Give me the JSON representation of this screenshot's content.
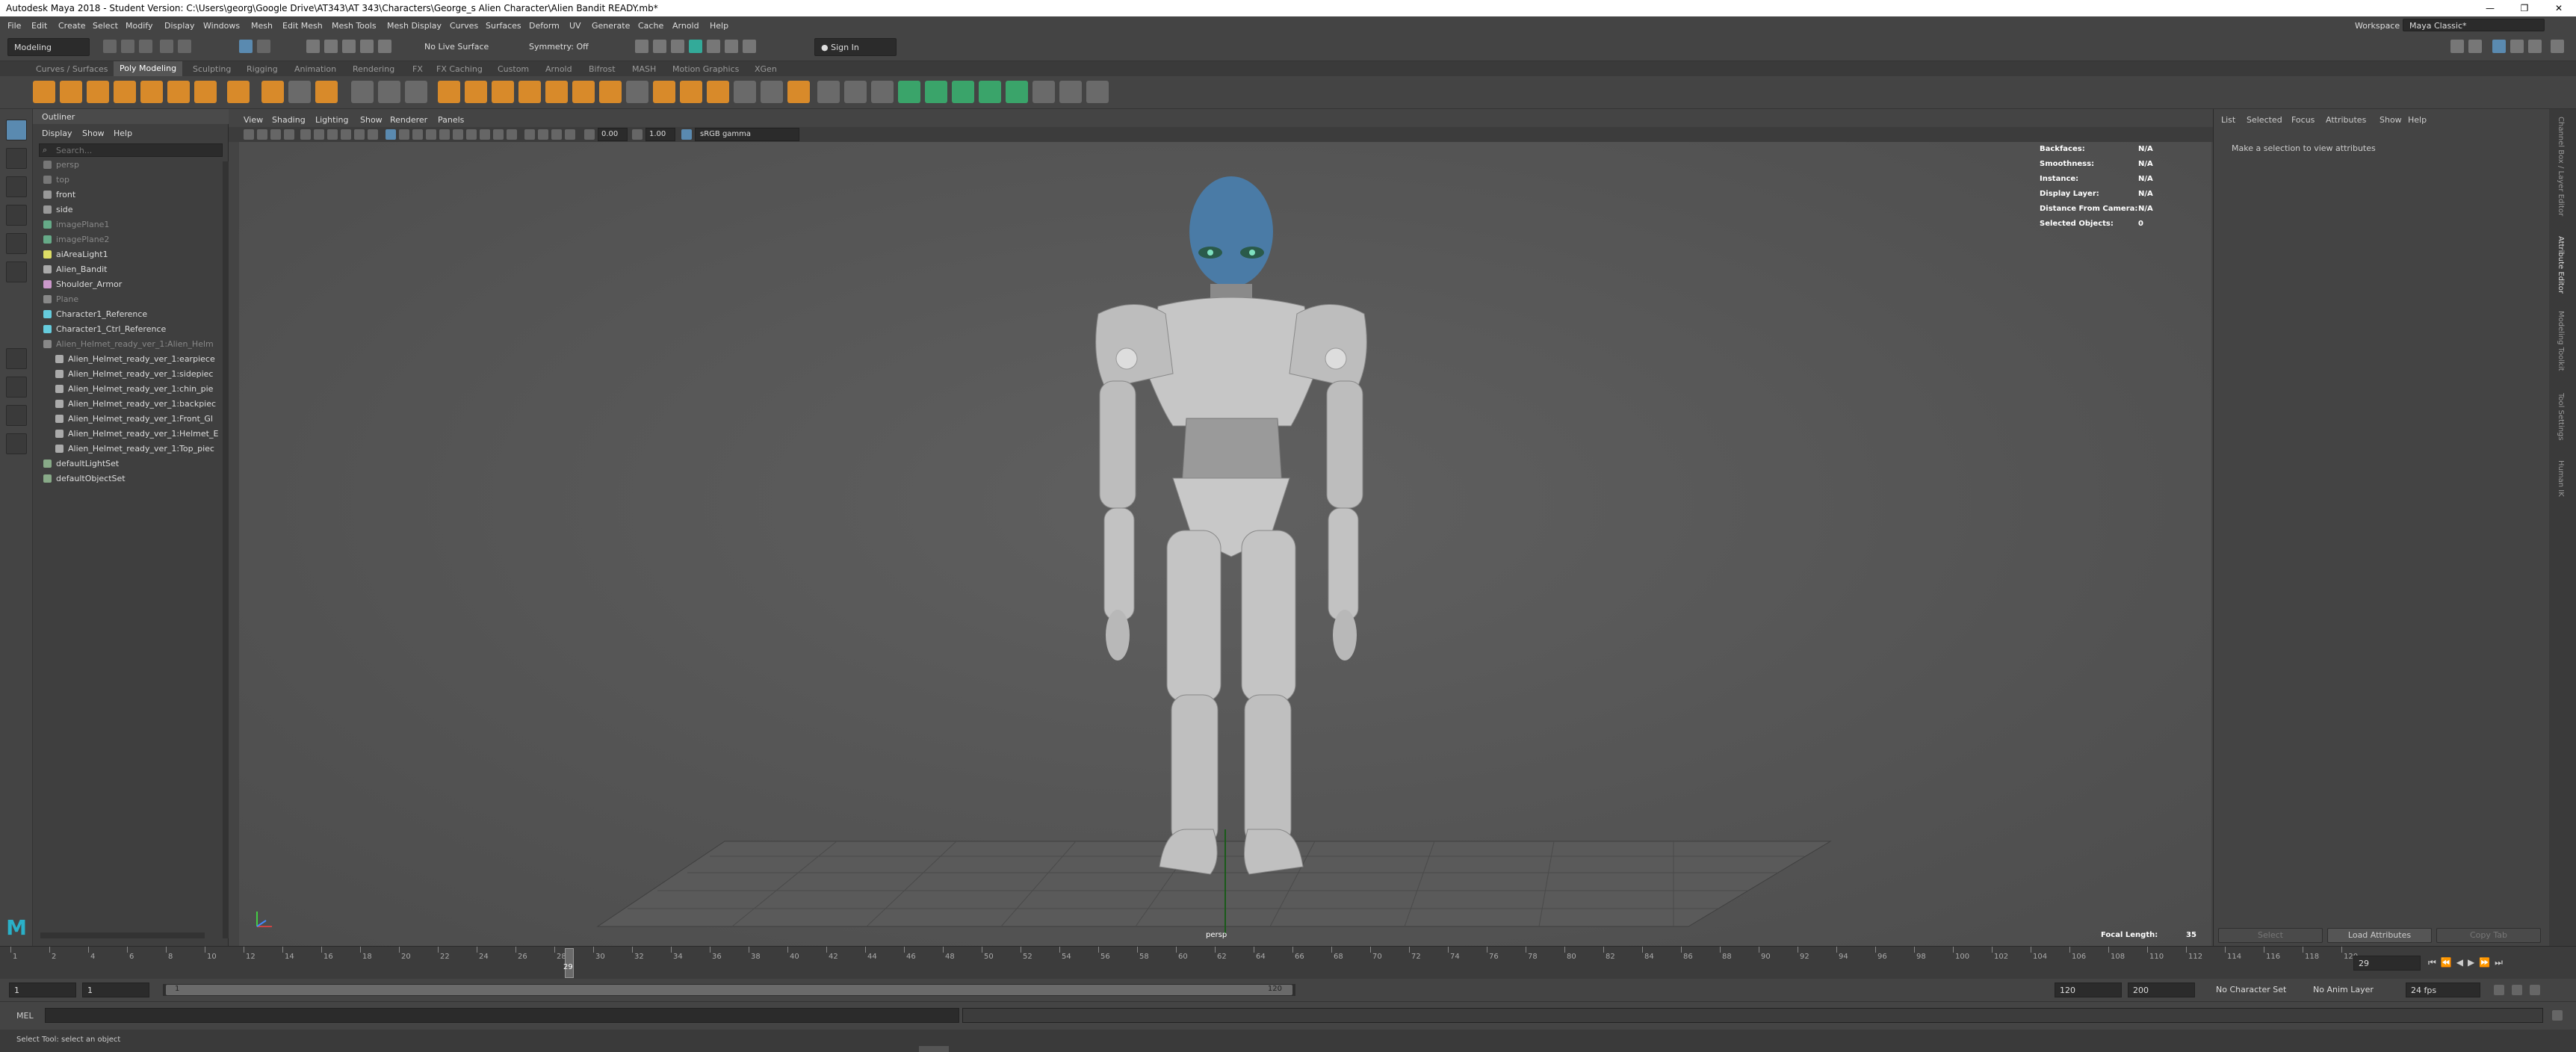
{
  "window": {
    "title": "Autodesk Maya 2018 - Student Version: C:\\Users\\georg\\Google Drive\\AT343\\AT 343\\Characters\\George_s Alien Character\\Alien Bandit READY.mb*",
    "min": "—",
    "max": "❐",
    "close": "✕"
  },
  "menubar": {
    "items": [
      "File",
      "Edit",
      "Create",
      "Select",
      "Modify",
      "Display",
      "Windows",
      "Mesh",
      "Edit Mesh",
      "Mesh Tools",
      "Mesh Display",
      "Curves",
      "Surfaces",
      "Deform",
      "UV",
      "Generate",
      "Cache",
      "Arnold",
      "Help"
    ],
    "workspace_label": "Workspace :",
    "workspace_value": "Maya Classic*"
  },
  "statusline": {
    "mode": "Modeling",
    "live_surface": "No Live Surface",
    "symmetry": "Symmetry: Off",
    "sign_in": "Sign In"
  },
  "shelf": {
    "tabs": [
      "Curves / Surfaces",
      "Poly Modeling",
      "Sculpting",
      "Rigging",
      "Animation",
      "Rendering",
      "FX",
      "FX Caching",
      "Custom",
      "Arnold",
      "Bifrost",
      "MASH",
      "Motion Graphics",
      "XGen"
    ],
    "active_tab": "Poly Modeling"
  },
  "outliner": {
    "title": "Outliner",
    "menu": [
      "Display",
      "Show",
      "Help"
    ],
    "search_placeholder": "Search...",
    "items": [
      {
        "label": "persp",
        "dim": true,
        "indent": 0,
        "color": "#777"
      },
      {
        "label": "top",
        "dim": true,
        "indent": 0,
        "color": "#777"
      },
      {
        "label": "front",
        "dim": false,
        "indent": 0,
        "color": "#999"
      },
      {
        "label": "side",
        "dim": false,
        "indent": 0,
        "color": "#999"
      },
      {
        "label": "imagePlane1",
        "dim": true,
        "indent": 0,
        "color": "#6a8"
      },
      {
        "label": "imagePlane2",
        "dim": true,
        "indent": 0,
        "color": "#6a8"
      },
      {
        "label": "aiAreaLight1",
        "dim": false,
        "indent": 0,
        "color": "#dd6"
      },
      {
        "label": "Alien_Bandit",
        "dim": false,
        "indent": 0,
        "color": "#aaa"
      },
      {
        "label": "Shoulder_Armor",
        "dim": false,
        "indent": 0,
        "color": "#c9c"
      },
      {
        "label": "Plane",
        "dim": true,
        "indent": 0,
        "color": "#888"
      },
      {
        "label": "Character1_Reference",
        "dim": false,
        "indent": 0,
        "color": "#6cd"
      },
      {
        "label": "Character1_Ctrl_Reference",
        "dim": false,
        "indent": 0,
        "color": "#6cd"
      },
      {
        "label": "Alien_Helmet_ready_ver_1:Alien_Helm",
        "dim": true,
        "indent": 0,
        "color": "#888"
      },
      {
        "label": "Alien_Helmet_ready_ver_1:earpiece",
        "dim": false,
        "indent": 1,
        "color": "#aaa"
      },
      {
        "label": "Alien_Helmet_ready_ver_1:sidepiec",
        "dim": false,
        "indent": 1,
        "color": "#aaa"
      },
      {
        "label": "Alien_Helmet_ready_ver_1:chin_pie",
        "dim": false,
        "indent": 1,
        "color": "#aaa"
      },
      {
        "label": "Alien_Helmet_ready_ver_1:backpiec",
        "dim": false,
        "indent": 1,
        "color": "#aaa"
      },
      {
        "label": "Alien_Helmet_ready_ver_1:Front_Gl",
        "dim": false,
        "indent": 1,
        "color": "#aaa"
      },
      {
        "label": "Alien_Helmet_ready_ver_1:Helmet_E",
        "dim": false,
        "indent": 1,
        "color": "#aaa"
      },
      {
        "label": "Alien_Helmet_ready_ver_1:Top_piec",
        "dim": false,
        "indent": 1,
        "color": "#aaa"
      },
      {
        "label": "defaultLightSet",
        "dim": false,
        "indent": 0,
        "color": "#8a8"
      },
      {
        "label": "defaultObjectSet",
        "dim": false,
        "indent": 0,
        "color": "#8a8"
      }
    ]
  },
  "viewport": {
    "menu": [
      "View",
      "Shading",
      "Lighting",
      "Show",
      "Renderer",
      "Panels"
    ],
    "exposure": "0.00",
    "gamma": "1.00",
    "color_space": "sRGB gamma",
    "camera_label": "persp",
    "focal_length_label": "Focal Length:",
    "focal_length": "35",
    "hud": [
      {
        "label": "Backfaces:",
        "value": "N/A"
      },
      {
        "label": "Smoothness:",
        "value": "N/A"
      },
      {
        "label": "Instance:",
        "value": "N/A"
      },
      {
        "label": "Display Layer:",
        "value": "N/A"
      },
      {
        "label": "Distance From Camera:",
        "value": "N/A"
      },
      {
        "label": "Selected Objects:",
        "value": "0"
      }
    ]
  },
  "attribute_editor": {
    "menu": [
      "List",
      "Selected",
      "Focus",
      "Attributes",
      "Show",
      "Help"
    ],
    "message": "Make a selection to view attributes",
    "select_btn": "Select",
    "load_btn": "Load Attributes",
    "copy_tab_btn": "Copy Tab",
    "side_tabs": [
      "Channel Box / Layer Editor",
      "Attribute Editor",
      "Modeling Toolkit",
      "Tool Settings",
      "Human IK"
    ]
  },
  "timeslider": {
    "ticks": [
      "1",
      "2",
      "4",
      "6",
      "8",
      "10",
      "12",
      "14",
      "16",
      "18",
      "20",
      "22",
      "24",
      "26",
      "28",
      "30",
      "32",
      "34",
      "36",
      "38",
      "40",
      "42",
      "44",
      "46",
      "48",
      "50",
      "52",
      "54",
      "56",
      "58",
      "60",
      "62",
      "64",
      "66",
      "68",
      "70",
      "72",
      "74",
      "76",
      "78",
      "80",
      "82",
      "84",
      "86",
      "88",
      "90",
      "92",
      "94",
      "96",
      "98",
      "100",
      "102",
      "104",
      "106",
      "108",
      "110",
      "112",
      "114",
      "116",
      "118",
      "120"
    ],
    "current": "29",
    "current_field": "29"
  },
  "range": {
    "start": "1",
    "start2": "1",
    "slider_start": "1",
    "slider_end": "120",
    "end": "120",
    "end2": "200",
    "character_set": "No Character Set",
    "anim_layer": "No Anim Layer",
    "fps": "24 fps"
  },
  "cmdline": {
    "label": "MEL"
  },
  "helpline": {
    "text": "Select Tool: select an object"
  }
}
